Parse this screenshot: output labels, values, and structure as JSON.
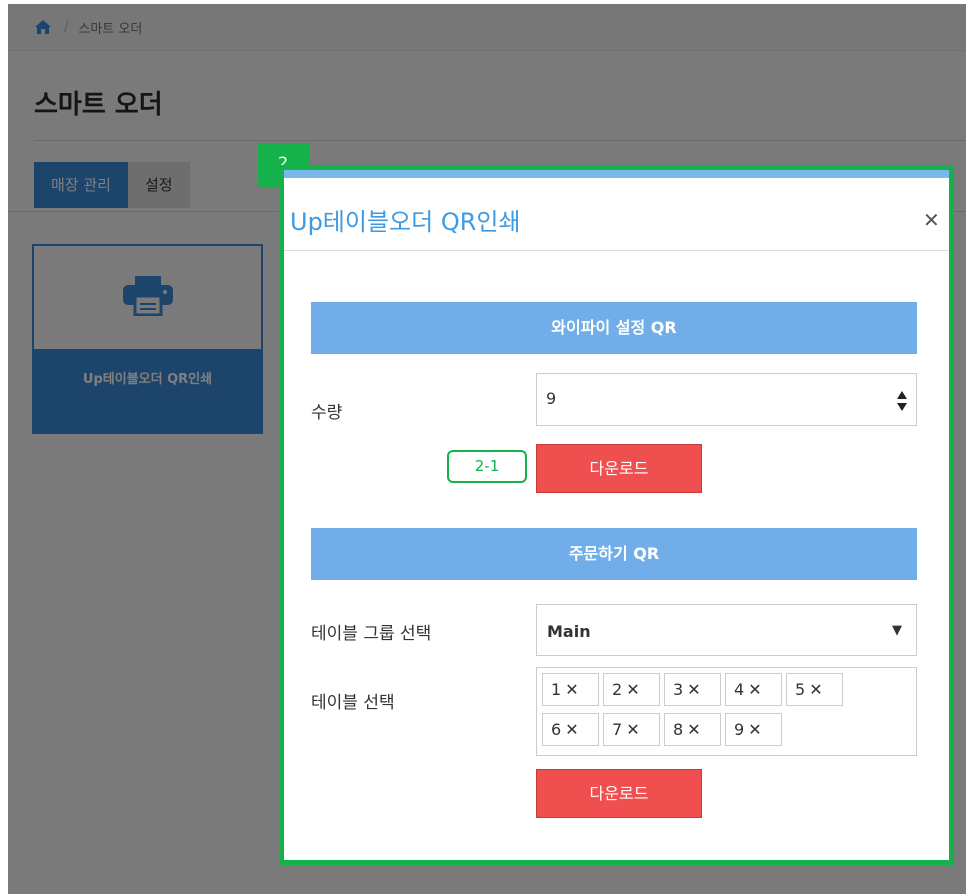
{
  "breadcrumb": {
    "home_icon": "home-icon",
    "separator": "/",
    "current": "스마트 오더"
  },
  "page": {
    "title": "스마트 오더"
  },
  "tabs": [
    {
      "label": "매장 관리",
      "active": true
    },
    {
      "label": "설정",
      "active": false
    }
  ],
  "card": {
    "icon": "printer-icon",
    "label": "Up테이블오더 QR인쇄"
  },
  "modal": {
    "title": "Up테이블오더 QR인쇄",
    "close_icon": "close-icon",
    "wifi_section": {
      "header": "와이파이 설정 QR",
      "quantity_label": "수량",
      "quantity_value": "9",
      "download_label": "다운로드"
    },
    "order_section": {
      "header": "주문하기 QR",
      "group_label": "테이블 그룹 선택",
      "group_value": "Main",
      "table_label": "테이블 선택",
      "tables": [
        "1",
        "2",
        "3",
        "4",
        "5",
        "6",
        "7",
        "8",
        "9"
      ],
      "download_label": "다운로드"
    }
  },
  "annotations": {
    "modal_badge": "2",
    "download_badge": "2-1"
  },
  "colors": {
    "accent": "#3a8ad7",
    "section_header": "#70ade9",
    "danger": "#ef4f4f",
    "annotation": "#15b24b"
  }
}
